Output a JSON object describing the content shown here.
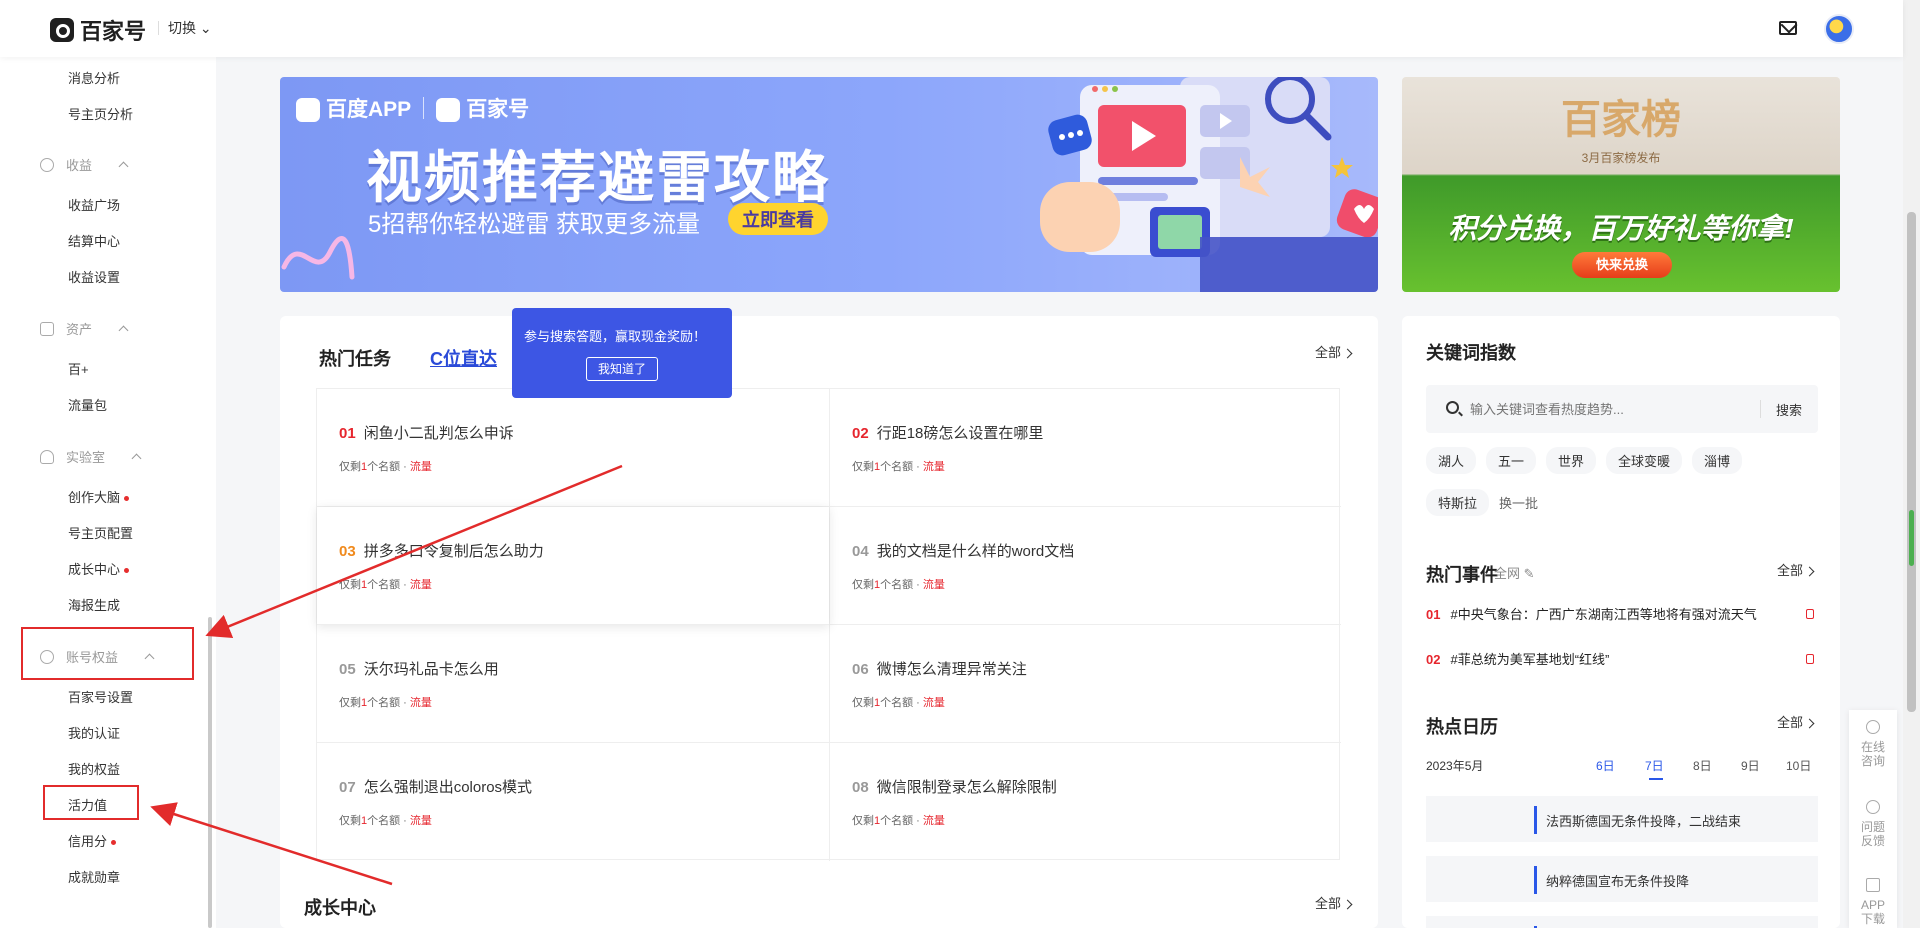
{
  "header": {
    "logo_text": "百家号",
    "switch_label": "切换"
  },
  "sidebar": {
    "items_top": [
      "消息分析",
      "号主页分析"
    ],
    "groups": [
      {
        "label": "收益",
        "items": [
          "收益广场",
          "结算中心",
          "收益设置"
        ]
      },
      {
        "label": "资产",
        "items": [
          "百+",
          "流量包"
        ]
      },
      {
        "label": "实验室",
        "items": [
          "创作大脑",
          "号主页配置",
          "成长中心",
          "海报生成"
        ]
      },
      {
        "label": "账号权益",
        "items": [
          "百家号设置",
          "我的认证",
          "我的权益",
          "活力值",
          "信用分",
          "成就勋章"
        ]
      }
    ]
  },
  "banner": {
    "brand_a": "百度APP",
    "brand_b": "百家号",
    "title": "视频推荐避雷攻略",
    "subtitle": "5招帮你轻松避雷  获取更多流量",
    "cta": "立即查看"
  },
  "side_banner": {
    "title": "百家榜",
    "subtitle": "3月百家榜发布",
    "headline": "积分兑换，百万好礼等你拿!",
    "button": "快来兑换"
  },
  "hot_tasks": {
    "title": "热门任务",
    "tab_link": "C位直达",
    "all_label": "全部",
    "tooltip_text": "参与搜索答题，赢取现金奖励！",
    "tooltip_button": "我知道了",
    "tasks": [
      {
        "num": "01",
        "title": "闲鱼小二乱判怎么申诉",
        "s1": "仅剩",
        "count": "1",
        "s2": "个名额 · ",
        "tag": "流量"
      },
      {
        "num": "02",
        "title": "行距18磅怎么设置在哪里",
        "s1": "仅剩",
        "count": "1",
        "s2": "个名额 · ",
        "tag": "流量"
      },
      {
        "num": "03",
        "title": "拼多多口令复制后怎么助力",
        "s1": "仅剩",
        "count": "1",
        "s2": "个名额 · ",
        "tag": "流量"
      },
      {
        "num": "04",
        "title": "我的文档是什么样的word文档",
        "s1": "仅剩",
        "count": "1",
        "s2": "个名额 · ",
        "tag": "流量"
      },
      {
        "num": "05",
        "title": "沃尔玛礼品卡怎么用",
        "s1": "仅剩",
        "count": "1",
        "s2": "个名额 · ",
        "tag": "流量"
      },
      {
        "num": "06",
        "title": "微博怎么清理异常关注",
        "s1": "仅剩",
        "count": "1",
        "s2": "个名额 · ",
        "tag": "流量"
      },
      {
        "num": "07",
        "title": "怎么强制退出coloros模式",
        "s1": "仅剩",
        "count": "1",
        "s2": "个名额 · ",
        "tag": "流量"
      },
      {
        "num": "08",
        "title": "微信限制登录怎么解除限制",
        "s1": "仅剩",
        "count": "1",
        "s2": "个名额 · ",
        "tag": "流量"
      }
    ]
  },
  "growth": {
    "title": "成长中心",
    "all_label": "全部"
  },
  "keyword": {
    "title": "关键词指数",
    "placeholder": "输入关键词查看热度趋势...",
    "search_btn": "搜索",
    "tags": [
      "湖人",
      "五一",
      "世界",
      "全球变暖",
      "淄博",
      "特斯拉"
    ],
    "refresh": "换一批"
  },
  "hot_events": {
    "title": "热门事件",
    "scope": "全网",
    "all_label": "全部",
    "items": [
      {
        "num": "01",
        "text": "#中央气象台：广西广东湖南江西等地将有强对流天气"
      },
      {
        "num": "02",
        "text": "#菲总统为美军基地划“红线”"
      }
    ]
  },
  "calendar": {
    "title": "热点日历",
    "all_label": "全部",
    "month": "2023年5月",
    "days": [
      "6日",
      "7日",
      "8日",
      "9日",
      "10日"
    ],
    "events": [
      "法西斯德国无条件投降，二战结束",
      "纳粹德国宣布无条件投降"
    ]
  },
  "float_tools": {
    "consult_a": "在线",
    "consult_b": "咨询",
    "feedback_a": "问题",
    "feedback_b": "反馈",
    "app_a": "APP",
    "app_b": "下载"
  },
  "colors": {
    "accent_blue": "#2a57e8",
    "highlight_red": "#e22b2b",
    "tooltip_bg": "#3d56e4"
  }
}
